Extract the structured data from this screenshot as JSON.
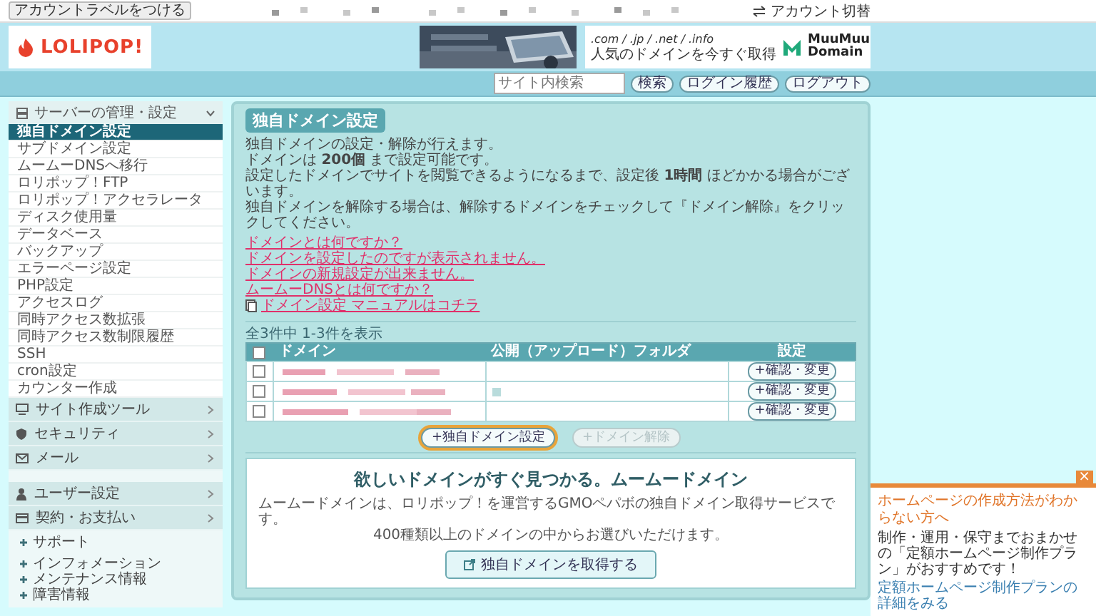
{
  "top_bar": {
    "label_button": "アカウントラベルをつける",
    "switch_button": "アカウント切替"
  },
  "header": {
    "logo": "LOLIPOP!",
    "domain_ad": {
      "tlds": ".com / .jp / .net / .info",
      "tagline": "人気のドメインを今すぐ取得",
      "brand": "MuuMuu Domain"
    }
  },
  "nav": {
    "search": {
      "placeholder": "サイト内検索"
    },
    "buttons": [
      "検索",
      "ログイン履歴",
      "ログアウト"
    ]
  },
  "sidebar": {
    "section": {
      "label": "サーバーの管理・設定",
      "expanded": true
    },
    "items": [
      {
        "label": "独自ドメイン設定",
        "selected": true
      },
      {
        "label": "サブドメイン設定",
        "selected": false
      },
      {
        "label": "ムームーDNSへ移行",
        "selected": false
      },
      {
        "label": "ロリポップ！FTP",
        "selected": false
      },
      {
        "label": "ロリポップ！アクセラレータ",
        "selected": false
      },
      {
        "label": "ディスク使用量",
        "selected": false
      },
      {
        "label": "データベース",
        "selected": false
      },
      {
        "label": "バックアップ",
        "selected": false
      },
      {
        "label": "エラーページ設定",
        "selected": false
      },
      {
        "label": "PHP設定",
        "selected": false
      },
      {
        "label": "アクセスログ",
        "selected": false
      },
      {
        "label": "同時アクセス数拡張",
        "selected": false
      },
      {
        "label": "同時アクセス数制限履歴",
        "selected": false
      },
      {
        "label": "SSH",
        "selected": false
      },
      {
        "label": "cron設定",
        "selected": false
      },
      {
        "label": "カウンター作成",
        "selected": false
      }
    ],
    "categories": [
      {
        "label": "サイト作成ツール",
        "kind": "monitor",
        "expanded": false
      },
      {
        "label": "セキュリティ",
        "kind": "shield",
        "expanded": false
      },
      {
        "label": "メール",
        "kind": "mail",
        "expanded": false
      },
      {
        "label": "ユーザー設定",
        "kind": "user",
        "expanded": false
      },
      {
        "label": "契約・お支払い",
        "kind": "card",
        "expanded": false
      }
    ],
    "links": [
      [
        "サポート"
      ],
      [
        "インフォメーション",
        "メンテナンス情報",
        "障害情報"
      ]
    ]
  },
  "main": {
    "title": "独自ドメイン設定",
    "intro": [
      "独自ドメインの設定・解除が行えます。",
      "ドメインは **200個** まで設定可能です。",
      "設定したドメインでサイトを閲覧できるようになるまで、設定後 **1時間** ほどかかる場合がございます。",
      "独自ドメインを解除する場合は、解除するドメインをチェックして『ドメイン解除』をクリックしてください。"
    ],
    "faq_links": [
      "ドメインとは何ですか？",
      "ドメインを設定したのですが表示されません。",
      "ドメインの新規設定が出来ません。",
      "ムームーDNSとは何ですか？"
    ],
    "manual_link": "ドメイン設定 マニュアルはコチラ",
    "count": "全3件中 1-3件を表示",
    "table": {
      "select_all": {
        "checked": false
      },
      "columns": [
        "ドメイン",
        "公開（アップロード）フォルダ",
        "設定"
      ],
      "rows": [
        {
          "checked": false,
          "folder_blurred": false,
          "button": "+確認・変更"
        },
        {
          "checked": false,
          "folder_blurred": true,
          "button": "+確認・変更"
        },
        {
          "checked": false,
          "folder_blurred": false,
          "button": "+確認・変更"
        }
      ]
    },
    "actions": [
      {
        "label": "+独自ドメイン設定",
        "disabled": false,
        "highlighted": true
      },
      {
        "label": "+ドメイン解除",
        "disabled": true,
        "highlighted": false
      }
    ],
    "promo": {
      "title": "欲しいドメインがすぐ見つかる。ムームードメイン",
      "text": [
        "ムームードメインは、ロリポップ！を運営するGMOペパボの独自ドメイン取得サービスです。",
        "400種類以上のドメインの中からお選びいただけます。"
      ],
      "button": "独自ドメインを取得する"
    }
  },
  "popup": {
    "close": "×",
    "title": "ホームページの作成方法がわからない方へ",
    "body": "制作・運用・保守までおまかせの「定額ホームページ制作プラン」がおすすめです！",
    "link": "定額ホームページ制作プランの詳細をみる"
  }
}
